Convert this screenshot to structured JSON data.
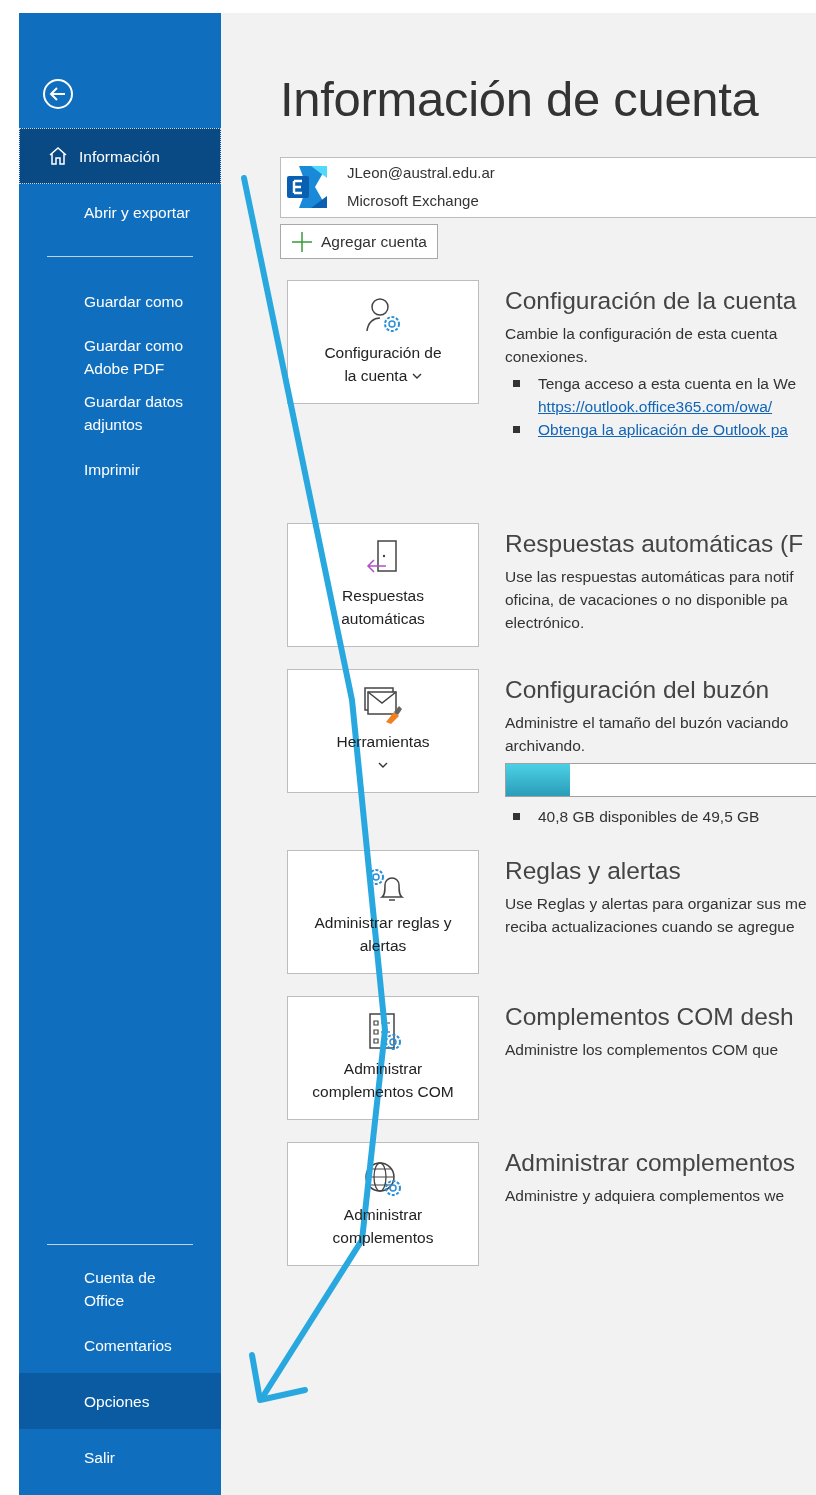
{
  "sidebar": {
    "primary": [
      {
        "label": "Información",
        "selected": true,
        "highlighted": false
      },
      {
        "label": "Abrir y exportar",
        "selected": false,
        "highlighted": false
      }
    ],
    "save": [
      {
        "label": "Guardar como",
        "selected": false,
        "highlighted": false
      },
      {
        "label": "Guardar como Adobe PDF",
        "selected": false,
        "highlighted": false
      },
      {
        "label": "Guardar datos adjuntos",
        "selected": false,
        "highlighted": false
      },
      {
        "label": "Imprimir",
        "selected": false,
        "highlighted": false
      }
    ],
    "footer": [
      {
        "label": "Cuenta de Office",
        "selected": false,
        "highlighted": false
      },
      {
        "label": "Comentarios",
        "selected": false,
        "highlighted": false
      },
      {
        "label": "Opciones",
        "selected": false,
        "highlighted": true
      },
      {
        "label": "Salir",
        "selected": false,
        "highlighted": false
      }
    ]
  },
  "title": "Información de cuenta",
  "account": {
    "email": "JLeon@austral.edu.ar",
    "type": "Microsoft Exchange"
  },
  "add_account_button": "Agregar cuenta",
  "sections": [
    {
      "tile": {
        "label": "Configuración de la cuenta",
        "dropdown": true
      },
      "heading": "Configuración de la cuenta",
      "lines": [
        "Cambie la configuración de esta cuenta",
        "conexiones."
      ],
      "bullets": [
        {
          "kind": "text",
          "text": "Tenga acceso a esta cuenta en la We"
        },
        {
          "kind": "link",
          "text": "https://outlook.office365.com/owa/"
        },
        {
          "kind": "bullet-link",
          "text": "Obtenga la aplicación de Outlook pa"
        }
      ]
    },
    {
      "tile": {
        "label": "Respuestas automáticas"
      },
      "heading": "Respuestas automáticas (F",
      "lines": [
        "Use las respuestas automáticas para notif",
        "oficina, de vacaciones o no disponible pa",
        "electrónico."
      ]
    },
    {
      "tile": {
        "label": "Herramientas",
        "dropdown": true
      },
      "heading": "Configuración del buzón",
      "lines": [
        "Administre el tamaño del buzón vaciando",
        "archivando."
      ],
      "progress": {
        "level": 0.18
      },
      "bullets": [
        {
          "kind": "text",
          "text": "40,8 GB disponibles de 49,5 GB"
        }
      ]
    },
    {
      "tile": {
        "label": "Administrar reglas y alertas"
      },
      "heading": "Reglas y alertas",
      "lines": [
        "Use Reglas y alertas para organizar sus me",
        "reciba actualizaciones cuando se agregue"
      ]
    },
    {
      "tile": {
        "label": "Administrar complementos COM"
      },
      "heading": "Complementos COM desh",
      "lines": [
        "Administre los complementos COM que"
      ]
    },
    {
      "tile": {
        "label": "Administrar complementos"
      },
      "heading": "Administrar complementos",
      "lines": [
        "Administre y adquiera complementos we"
      ]
    }
  ]
}
